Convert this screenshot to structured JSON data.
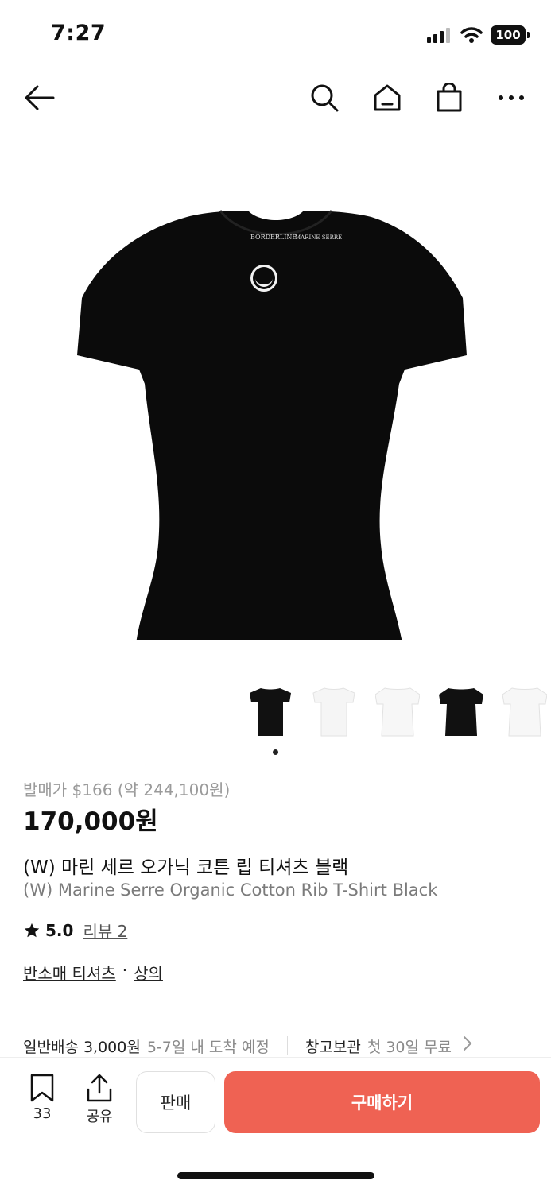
{
  "status_bar": {
    "time": "7:27",
    "battery": "100"
  },
  "nav": {
    "back_icon": "arrow-left-icon",
    "search_icon": "search-icon",
    "home_icon": "home-icon",
    "bag_icon": "shopping-bag-icon",
    "more_icon": "more-icon"
  },
  "product": {
    "release_price": "발매가 $166 (약 244,100원)",
    "price": "170,000원",
    "title_ko": "(W) 마린 세르 오가닉 코튼 립 티셔츠 블랙",
    "title_en": "(W) Marine Serre Organic Cotton Rib T-Shirt Black",
    "rating": "5.0",
    "review_label": "리뷰 2",
    "category_1": "반소매 티셔츠",
    "category_sep": "·",
    "category_2": "상의",
    "thumbnail_colors": [
      "#111111",
      "#f5f5f5",
      "#f5f5f5",
      "#111111",
      "#f5f5f5"
    ],
    "neck_text_left": "BORDERLINE",
    "neck_text_right": "MARINE SERRE"
  },
  "shipping": {
    "standard_label": "일반배송 3,000원",
    "standard_eta": "5-7일 내 도착 예정",
    "warehouse_label": "창고보관",
    "warehouse_note": "첫 30일 무료"
  },
  "bottom_bar": {
    "wish_count": "33",
    "share_label": "공유",
    "sell_label": "판매",
    "buy_label": "구매하기"
  },
  "colors": {
    "buy_button": "#ef6253",
    "text_primary": "#111111",
    "text_secondary": "#8a8a8a"
  }
}
